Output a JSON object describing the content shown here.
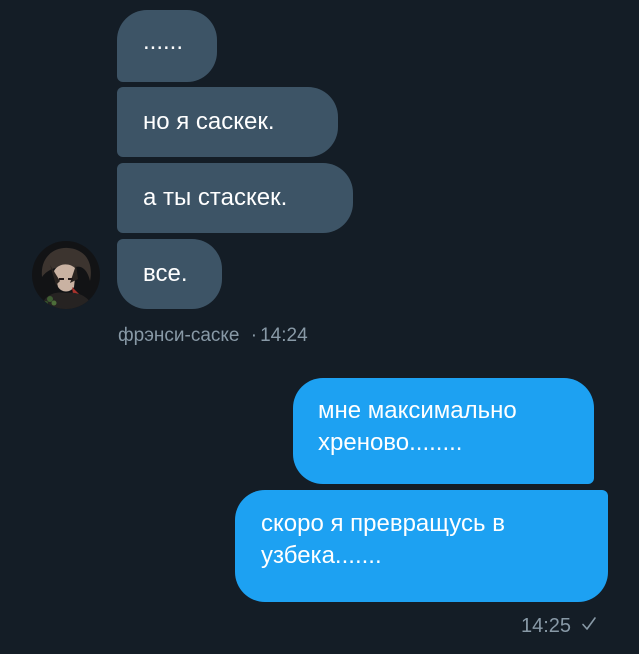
{
  "incoming": {
    "messages": [
      "......",
      "но я саскек.",
      "а ты стаскек.",
      "все."
    ],
    "sender": "фрэнси-саске",
    "separator": "·",
    "time": "14:24"
  },
  "outgoing": {
    "messages": [
      "мне максимально хреново........",
      "скоро я превращусь в узбека......."
    ],
    "time": "14:25",
    "status_icon": "check-icon"
  },
  "colors": {
    "background": "#141d26",
    "incoming_bubble": "#3d5466",
    "outgoing_bubble": "#1da1f2",
    "meta_text": "#8899a6"
  }
}
